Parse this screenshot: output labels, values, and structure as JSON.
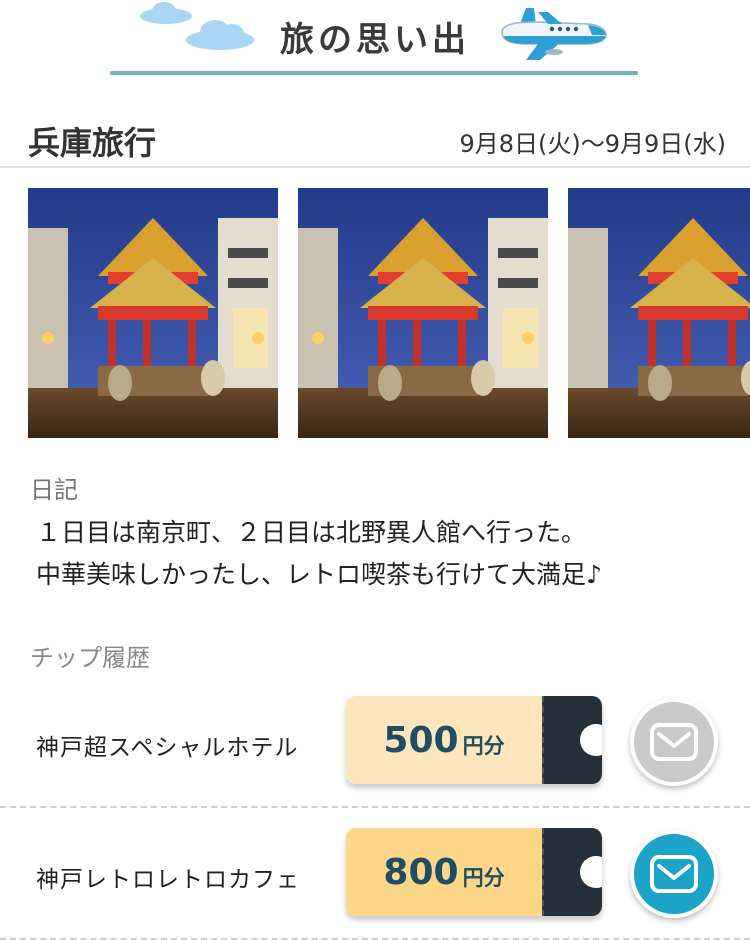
{
  "header": {
    "title": "旅の思い出"
  },
  "trip": {
    "title": "兵庫旅行",
    "dates": "9月8日(火)〜9月9日(水)"
  },
  "photos": [
    {
      "alt": "南京町の夜景"
    },
    {
      "alt": "南京町の夜景"
    },
    {
      "alt": "南京町の夜景"
    }
  ],
  "diary": {
    "label": "日記",
    "lines": [
      "１日目は南京町、２日目は北野異人館へ行った。",
      "中華美味しかったし、レトロ喫茶も行けて大満足♪"
    ]
  },
  "tips": {
    "label": "チップ履歴",
    "items": [
      {
        "name": "神戸超スペシャルホテル",
        "amount": "500",
        "unit": "円分",
        "ticket_color": "#fde6bd",
        "button_state": "disabled",
        "button_color": "#c9c9c9"
      },
      {
        "name": "神戸レトロレトロカフェ",
        "amount": "800",
        "unit": "円分",
        "ticket_color": "#fdd68a",
        "button_state": "enabled",
        "button_color": "#1ba4c8"
      }
    ]
  },
  "colors": {
    "accent_rule": "#6bb3c9",
    "ticket_stub": "#26303a",
    "amount_text": "#1f4e63"
  }
}
